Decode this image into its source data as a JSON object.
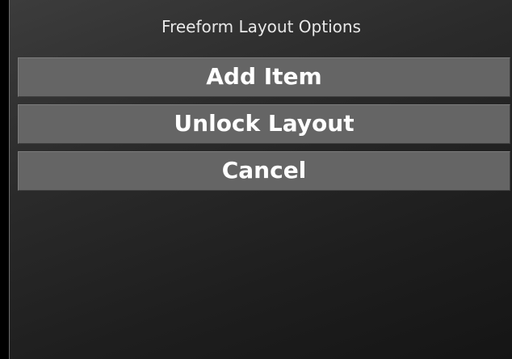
{
  "dialog": {
    "title": "Freeform Layout Options",
    "buttons": [
      {
        "label": "Add Item"
      },
      {
        "label": "Unlock Layout"
      },
      {
        "label": "Cancel"
      }
    ]
  },
  "colors": {
    "button_background": "#656565",
    "dialog_background_top": "#3c3c3c",
    "dialog_background_bottom": "#151515",
    "text": "#ffffff"
  }
}
